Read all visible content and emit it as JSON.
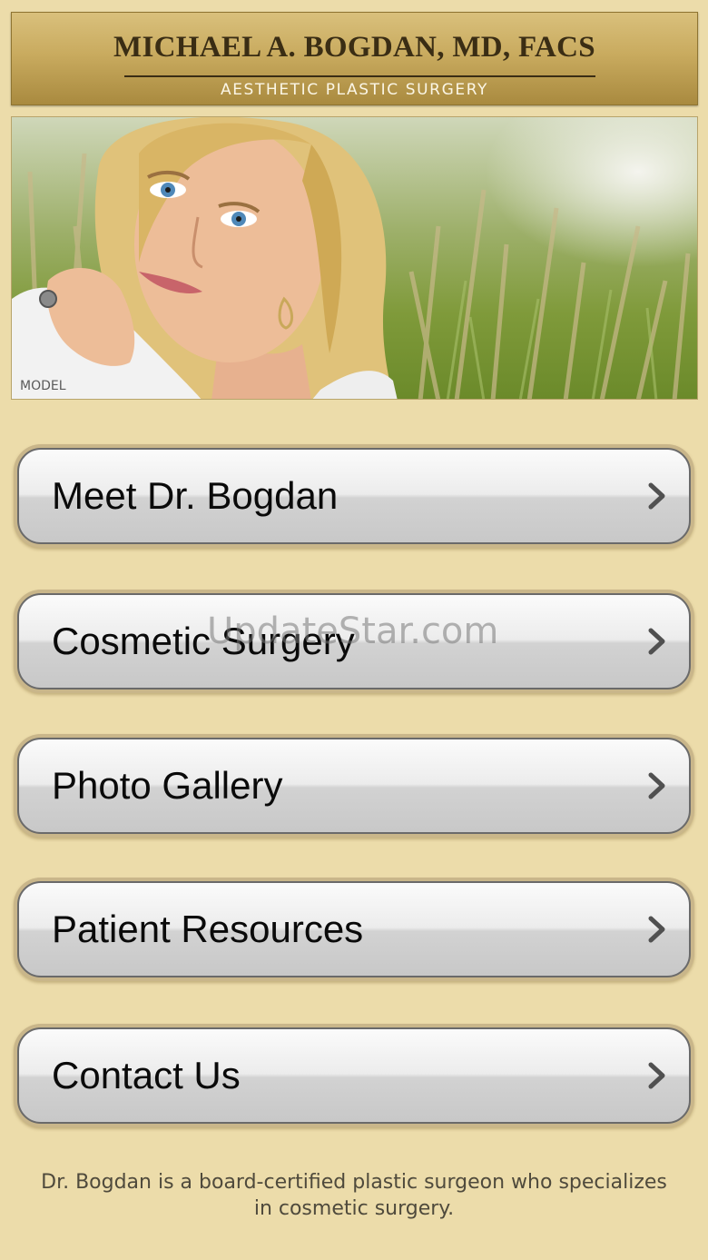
{
  "header": {
    "name": "MICHAEL A. BOGDAN, MD, FACS",
    "tagline": "AESTHETIC PLASTIC SURGERY"
  },
  "hero": {
    "caption": "MODEL"
  },
  "menu": [
    {
      "label": "Meet Dr. Bogdan",
      "icon": "chevron-right-icon"
    },
    {
      "label": "Cosmetic Surgery",
      "icon": "chevron-right-icon"
    },
    {
      "label": "Photo Gallery",
      "icon": "chevron-right-icon"
    },
    {
      "label": "Patient Resources",
      "icon": "chevron-right-icon"
    },
    {
      "label": "Contact Us",
      "icon": "chevron-right-icon"
    }
  ],
  "watermark": "UpdateStar.com",
  "footer": {
    "text": "Dr. Bogdan is a board-certified plastic surgeon who specializes in cosmetic surgery."
  },
  "colors": {
    "background": "#ecdcaa",
    "header_gold": "#c9ab5f",
    "title_text": "#3a2d14"
  }
}
